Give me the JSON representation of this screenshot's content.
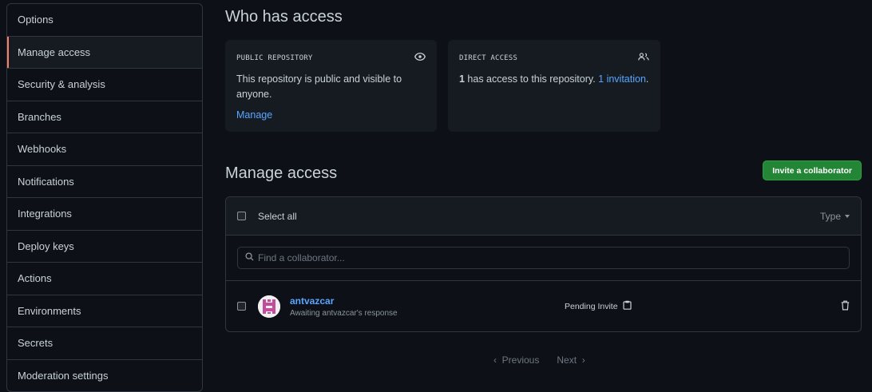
{
  "sidebar": {
    "items": [
      {
        "label": "Options"
      },
      {
        "label": "Manage access"
      },
      {
        "label": "Security & analysis"
      },
      {
        "label": "Branches"
      },
      {
        "label": "Webhooks"
      },
      {
        "label": "Notifications"
      },
      {
        "label": "Integrations"
      },
      {
        "label": "Deploy keys"
      },
      {
        "label": "Actions"
      },
      {
        "label": "Environments"
      },
      {
        "label": "Secrets"
      },
      {
        "label": "Moderation settings"
      }
    ],
    "active": "Manage access"
  },
  "who_has_access": {
    "title": "Who has access",
    "public_card": {
      "heading": "PUBLIC REPOSITORY",
      "icon": "eye-icon",
      "body": "This repository is public and visible to anyone.",
      "link": "Manage"
    },
    "direct_card": {
      "heading": "DIRECT ACCESS",
      "icon": "people-icon",
      "count": "1",
      "body": " has access to this repository. ",
      "link": "1 invitation",
      "suffix": "."
    }
  },
  "manage_access": {
    "title": "Manage access",
    "invite_button": "Invite a collaborator",
    "select_all": "Select all",
    "type_filter": "Type",
    "search_placeholder": "Find a collaborator...",
    "collaborators": [
      {
        "username": "antvazcar",
        "status_text": "Awaiting antvazcar's response",
        "role": "Pending Invite"
      }
    ]
  },
  "pagination": {
    "previous": "Previous",
    "next": "Next"
  },
  "colors": {
    "background": "#0d1117",
    "card": "#161b22",
    "link": "#58a6ff",
    "primary_button": "#238636",
    "active_indicator": "#f78166"
  }
}
